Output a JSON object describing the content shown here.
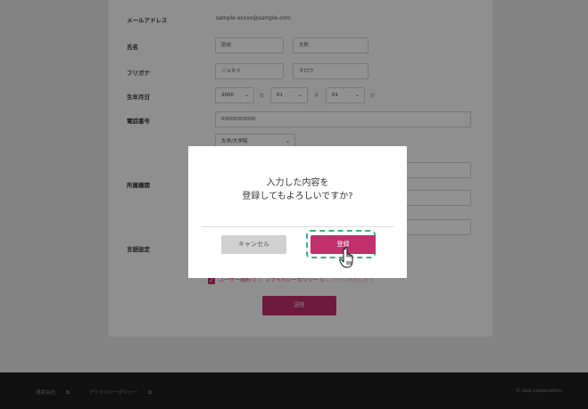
{
  "form": {
    "email": {
      "label": "メールアドレス",
      "value": "sample.xxxxx@sample.com"
    },
    "name": {
      "label": "氏名",
      "last": "助成",
      "first": "太郎"
    },
    "kana": {
      "label": "フリガナ",
      "last": "ジョセイ",
      "first": "タロウ"
    },
    "birth": {
      "label": "生年月日",
      "year": "2000",
      "year_unit": "年",
      "month": "01",
      "month_unit": "月",
      "day": "01",
      "day_unit": "日"
    },
    "phone": {
      "label": "電話番号",
      "value": "00000000000"
    },
    "affiliation": {
      "label": "所属機関",
      "type_select": "大学/大学院"
    },
    "language": {
      "label": "言語設定"
    }
  },
  "agree": {
    "terms_link": "ユーザー規約",
    "and": "と",
    "privacy_link": "プライバシーポリシー",
    "suffix": "について同意します"
  },
  "submit_label": "送信",
  "footer": {
    "company_link": "運営会社",
    "privacy_link": "プライバシーポリシー",
    "copyright": "© itup corporation."
  },
  "modal": {
    "message_line1": "入力した内容を",
    "message_line2": "登録してもよろしいですか?",
    "cancel_label": "キャンセル",
    "register_label": "登録"
  },
  "colors": {
    "accent": "#c0306c",
    "highlight": "#3fae80",
    "footer_bg": "#1f1f1f"
  },
  "icons": {
    "external_link": "external-link-icon",
    "cursor": "hand-pointer-icon",
    "chevron": "chevron-down-icon"
  }
}
